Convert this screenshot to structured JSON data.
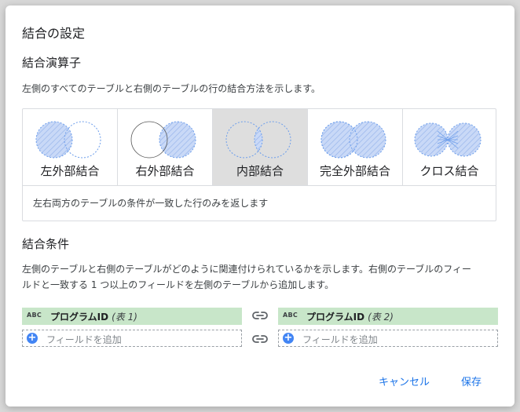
{
  "dialog": {
    "title": "結合の設定",
    "operator_section": {
      "heading": "結合演算子",
      "description": "左側のすべてのテーブルと右側のテーブルの行の結合方法を示します。",
      "join_types": [
        {
          "label": "左外部結合",
          "icon": "left-outer-join-icon"
        },
        {
          "label": "右外部結合",
          "icon": "right-outer-join-icon"
        },
        {
          "label": "内部結合",
          "icon": "inner-join-icon",
          "selected": true
        },
        {
          "label": "完全外部結合",
          "icon": "full-outer-join-icon"
        },
        {
          "label": "クロス結合",
          "icon": "cross-join-icon"
        }
      ],
      "selected_description": "左右両方のテーブルの条件が一致した行のみを返します"
    },
    "condition_section": {
      "heading": "結合条件",
      "description_line1": "左側のテーブルと右側のテーブルがどのように関連付けられているかを示します。右側のテーブルのフィー",
      "description_line2": "ルドと一致する 1 つ以上のフィールドを左側のテーブルから追加します。",
      "left_field": {
        "type_badge": "ABC",
        "name": "プログラムID",
        "table": "(表 1)"
      },
      "right_field": {
        "type_badge": "ABC",
        "name": "プログラムID",
        "table": "(表 2)"
      },
      "add_field_placeholder": "フィールドを追加"
    },
    "buttons": {
      "cancel": "キャンセル",
      "save": "保存"
    },
    "colors": {
      "accent": "#1a73e8",
      "field_bg": "#c8e6c9",
      "venn_fill": "#c9d9f7",
      "venn_stroke": "#6d9eeb",
      "selected_bg": "#dedede"
    }
  }
}
